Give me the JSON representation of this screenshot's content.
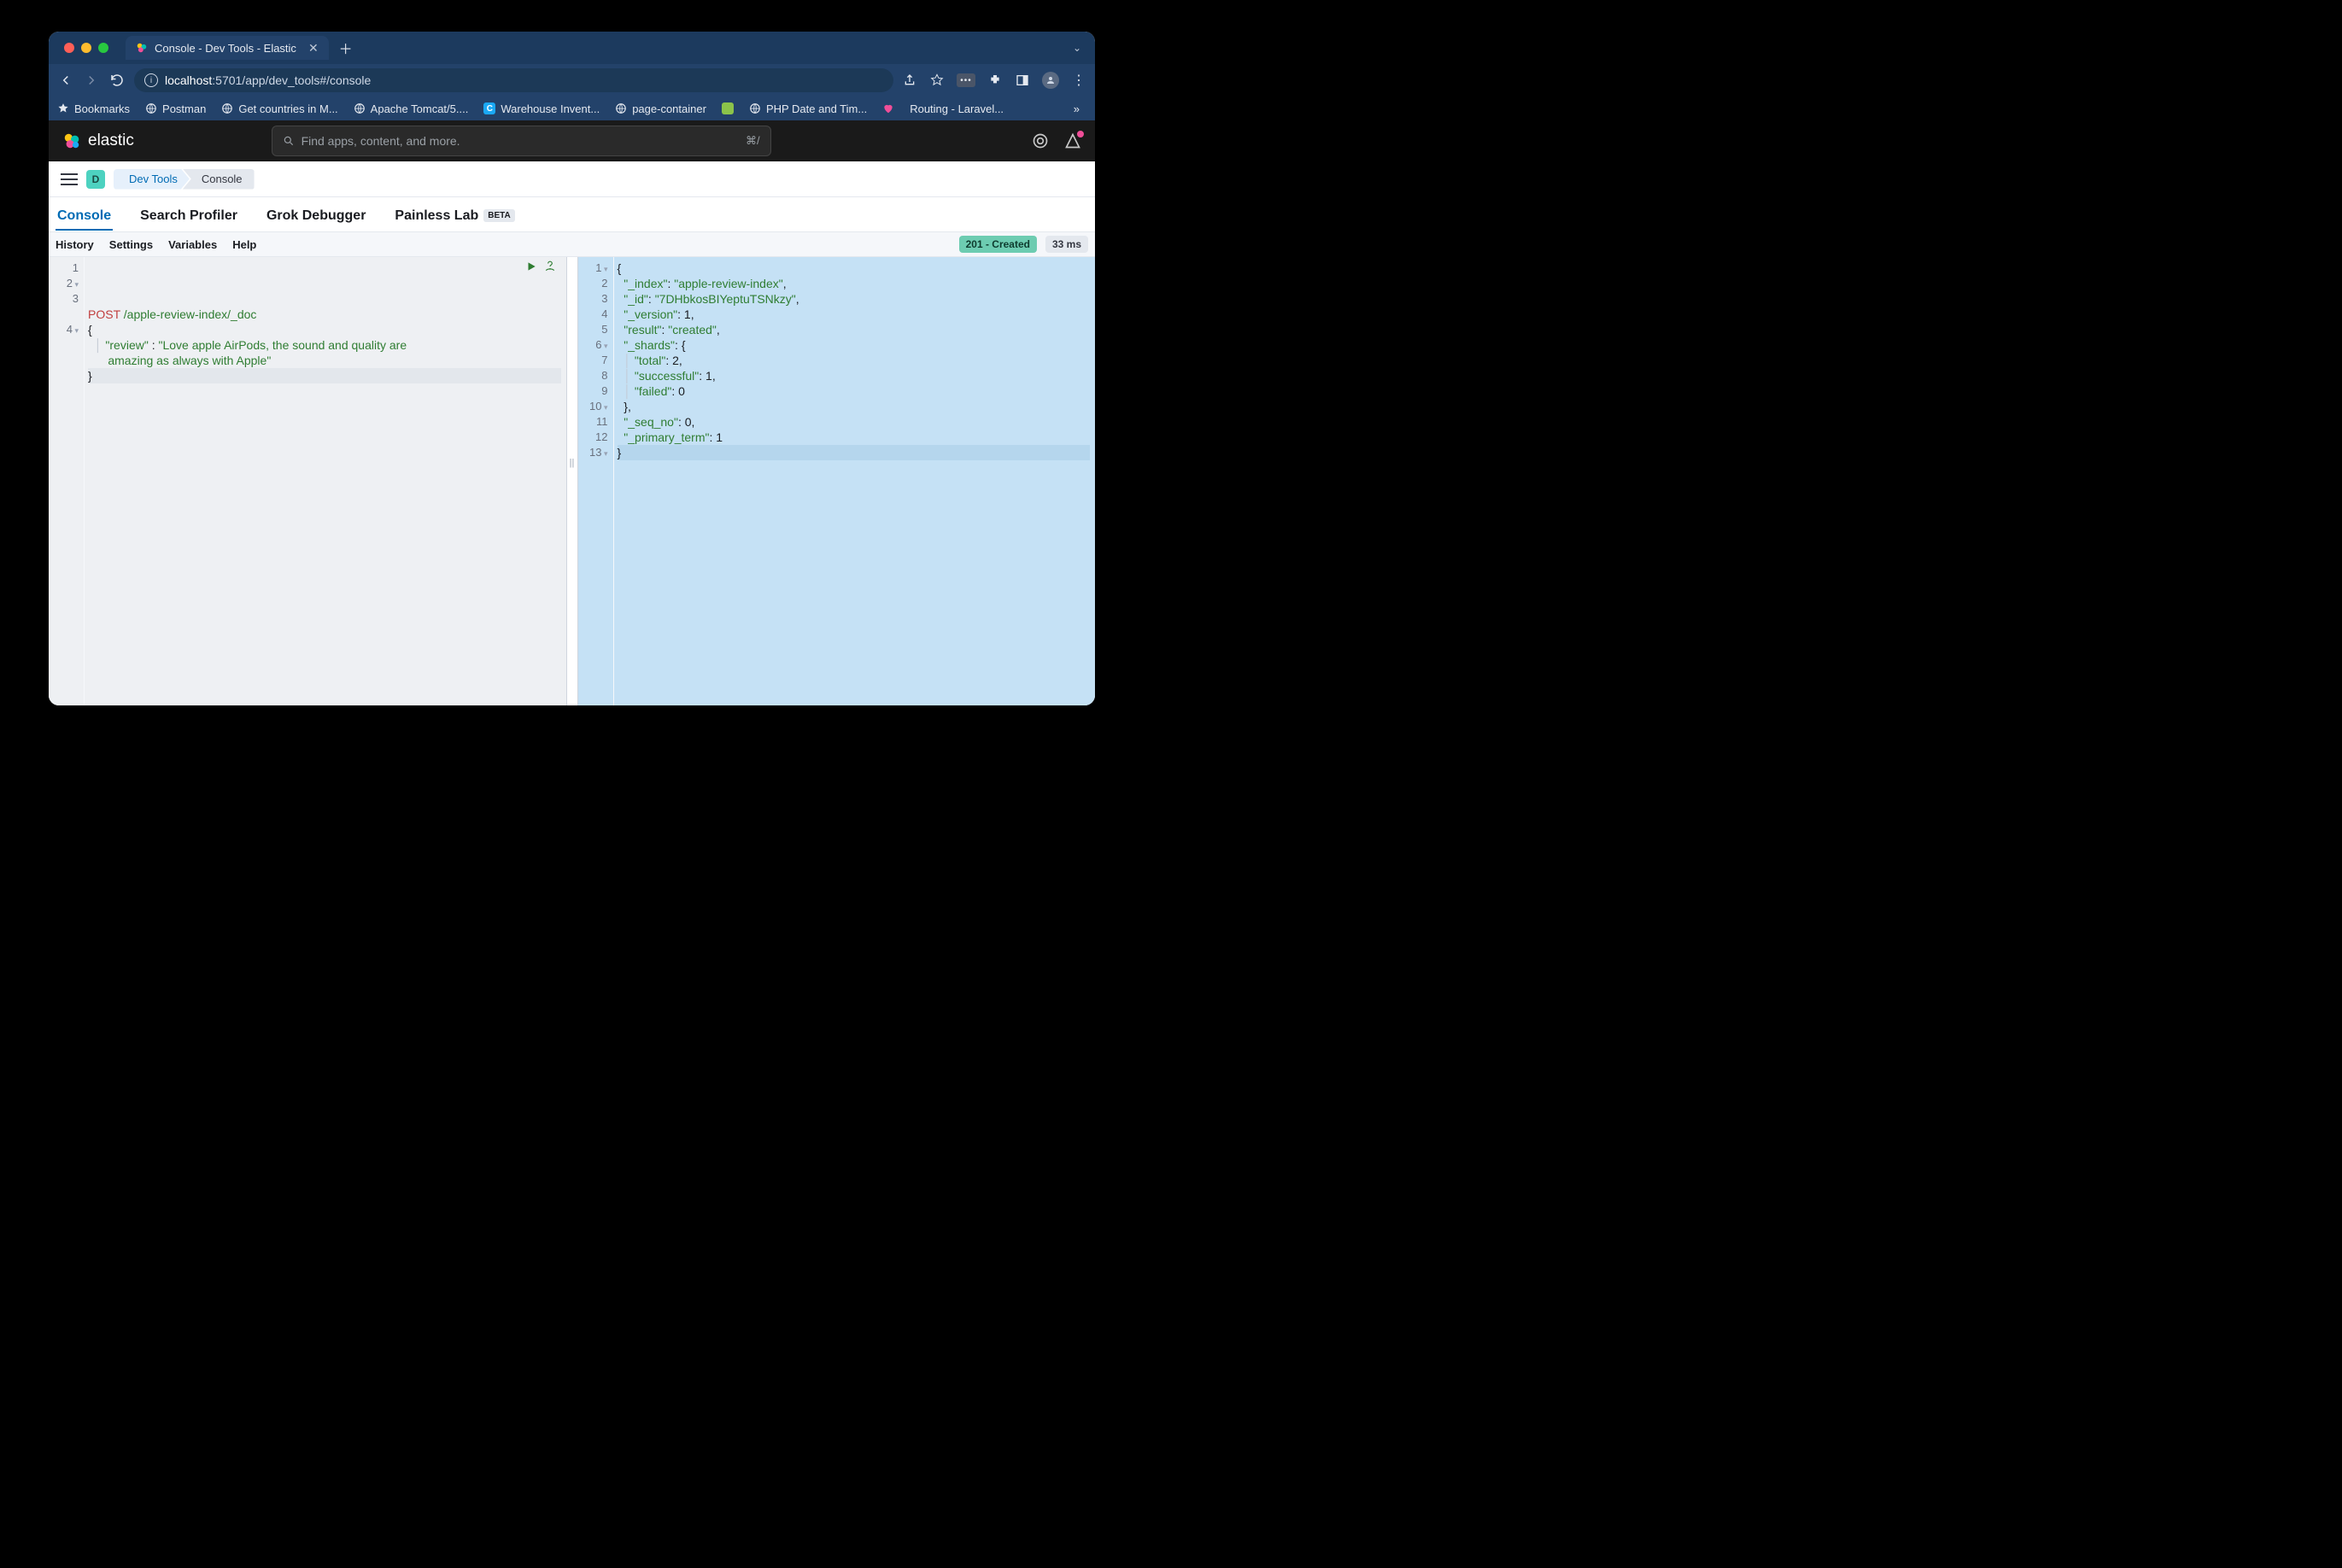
{
  "browser": {
    "tab_title": "Console - Dev Tools - Elastic",
    "url_host": "localhost",
    "url_rest": ":5701/app/dev_tools#/console",
    "bookmarks": [
      {
        "label": "Bookmarks",
        "type": "star"
      },
      {
        "label": "Postman",
        "type": "globe"
      },
      {
        "label": "Get countries in M...",
        "type": "globe"
      },
      {
        "label": "Apache Tomcat/5....",
        "type": "globe"
      },
      {
        "label": "Warehouse Invent...",
        "type": "c"
      },
      {
        "label": "page-container",
        "type": "globe"
      },
      {
        "label": "",
        "type": "sq"
      },
      {
        "label": "PHP Date and Tim...",
        "type": "globe"
      },
      {
        "label": "",
        "type": "heart"
      },
      {
        "label": "Routing - Laravel...",
        "type": "none"
      }
    ]
  },
  "elastic": {
    "brand": "elastic",
    "search_placeholder": "Find apps, content, and more.",
    "search_shortcut": "⌘/",
    "space_letter": "D",
    "breadcrumbs": [
      "Dev Tools",
      "Console"
    ],
    "tabs": [
      {
        "label": "Console",
        "active": true
      },
      {
        "label": "Search Profiler"
      },
      {
        "label": "Grok Debugger"
      },
      {
        "label": "Painless Lab",
        "beta": "BETA"
      }
    ],
    "tool_menu": [
      "History",
      "Settings",
      "Variables",
      "Help"
    ],
    "status_code": "201 - Created",
    "elapsed": "33 ms"
  },
  "request": {
    "lines": [
      {
        "n": "1",
        "html": "<span class='tok-method'>POST</span> <span class='tok-path'>/apple-review-index/_doc</span>"
      },
      {
        "n": "2",
        "fold": true,
        "html": "<span class='tok-punc'>{</span>"
      },
      {
        "n": "3",
        "html": "  <span class='guide'>│</span> <span class='tok-key'>\"review\"</span> <span class='tok-punc'>:</span> <span class='tok-str'>\"Love apple AirPods, the sound and quality are</span>"
      },
      {
        "n": "",
        "html": "      <span class='tok-str'>amazing as always with Apple\"</span>"
      },
      {
        "n": "4",
        "fold": true,
        "sel": true,
        "html": "<span class='tok-punc'>}</span>"
      }
    ]
  },
  "response": {
    "lines": [
      {
        "n": "1",
        "fold": true,
        "html": "<span class='tok-punc'>{</span>"
      },
      {
        "n": "2",
        "html": "  <span class='tok-key'>\"_index\"</span><span class='tok-punc'>:</span> <span class='tok-str'>\"apple-review-index\"</span><span class='tok-punc'>,</span>"
      },
      {
        "n": "3",
        "html": "  <span class='tok-key'>\"_id\"</span><span class='tok-punc'>:</span> <span class='tok-str'>\"7DHbkosBIYeptuTSNkzy\"</span><span class='tok-punc'>,</span>"
      },
      {
        "n": "4",
        "html": "  <span class='tok-key'>\"_version\"</span><span class='tok-punc'>:</span> <span class='tok-num'>1</span><span class='tok-punc'>,</span>"
      },
      {
        "n": "5",
        "html": "  <span class='tok-key'>\"result\"</span><span class='tok-punc'>:</span> <span class='tok-str'>\"created\"</span><span class='tok-punc'>,</span>"
      },
      {
        "n": "6",
        "fold": true,
        "html": "  <span class='tok-key'>\"_shards\"</span><span class='tok-punc'>:</span> <span class='tok-punc'>{</span>"
      },
      {
        "n": "7",
        "html": "  <span class='guide'>│</span> <span class='tok-key'>\"total\"</span><span class='tok-punc'>:</span> <span class='tok-num'>2</span><span class='tok-punc'>,</span>"
      },
      {
        "n": "8",
        "html": "  <span class='guide'>│</span> <span class='tok-key'>\"successful\"</span><span class='tok-punc'>:</span> <span class='tok-num'>1</span><span class='tok-punc'>,</span>"
      },
      {
        "n": "9",
        "html": "  <span class='guide'>│</span> <span class='tok-key'>\"failed\"</span><span class='tok-punc'>:</span> <span class='tok-num'>0</span>"
      },
      {
        "n": "10",
        "fold": true,
        "html": "  <span class='tok-punc'>},</span>"
      },
      {
        "n": "11",
        "html": "  <span class='tok-key'>\"_seq_no\"</span><span class='tok-punc'>:</span> <span class='tok-num'>0</span><span class='tok-punc'>,</span>"
      },
      {
        "n": "12",
        "html": "  <span class='tok-key'>\"_primary_term\"</span><span class='tok-punc'>:</span> <span class='tok-num'>1</span>"
      },
      {
        "n": "13",
        "fold": true,
        "last": true,
        "html": "<span class='tok-punc'>}</span>"
      }
    ]
  }
}
